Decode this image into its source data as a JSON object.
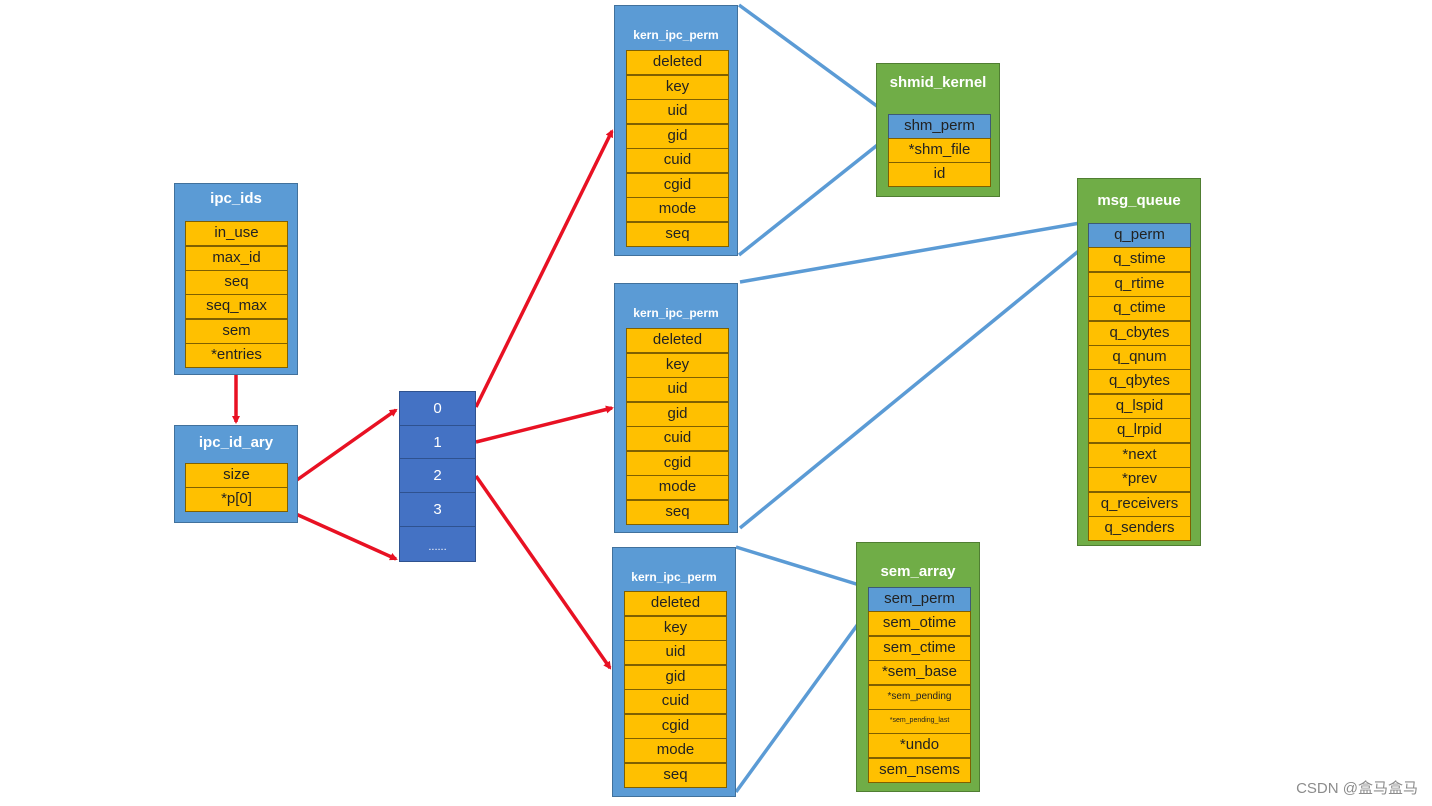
{
  "diagram": {
    "structs": {
      "ipc_ids": {
        "title": "ipc_ids",
        "fields": [
          "in_use",
          "max_id",
          "seq",
          "seq_max",
          "sem",
          "*entries"
        ]
      },
      "ipc_id_ary": {
        "title": "ipc_id_ary",
        "fields": [
          "size",
          "*p[0]"
        ]
      },
      "entries_array": {
        "cells": [
          "0",
          "1",
          "2",
          "3",
          "......"
        ]
      },
      "kern_ipc_perm_0": {
        "title": "kern_ipc_perm",
        "fields": [
          "deleted",
          "key",
          "uid",
          "gid",
          "cuid",
          "cgid",
          "mode",
          "seq"
        ]
      },
      "kern_ipc_perm_1": {
        "title": "kern_ipc_perm",
        "fields": [
          "deleted",
          "key",
          "uid",
          "gid",
          "cuid",
          "cgid",
          "mode",
          "seq"
        ]
      },
      "kern_ipc_perm_2": {
        "title": "kern_ipc_perm",
        "fields": [
          "deleted",
          "key",
          "uid",
          "gid",
          "cuid",
          "cgid",
          "mode",
          "seq"
        ]
      },
      "shmid_kernel": {
        "title": "shmid_kernel",
        "fields": [
          "shm_perm",
          "*shm_file",
          "id"
        ]
      },
      "msg_queue": {
        "title": "msg_queue",
        "fields": [
          "q_perm",
          "q_stime",
          "q_rtime",
          "q_ctime",
          "q_cbytes",
          "q_qnum",
          "q_qbytes",
          "q_lspid",
          "q_lrpid",
          "*next",
          "*prev",
          "q_receivers",
          "q_senders"
        ]
      },
      "sem_array": {
        "title": "sem_array",
        "fields": [
          "sem_perm",
          "sem_otime",
          "sem_ctime",
          "*sem_base",
          "*sem_pending",
          "*sem_pending_last",
          "*undo",
          "sem_nsems"
        ]
      }
    },
    "edges": [
      {
        "from": "ipc_ids.*entries",
        "to": "ipc_id_ary",
        "color": "#e81123"
      },
      {
        "from": "ipc_id_ary.*p[0]",
        "to": "entries_array.0",
        "color": "#e81123"
      },
      {
        "from": "ipc_id_ary.*p[0]",
        "to": "entries_array.end",
        "color": "#e81123"
      },
      {
        "from": "entries_array.0",
        "to": "kern_ipc_perm_0",
        "color": "#e81123"
      },
      {
        "from": "entries_array.1",
        "to": "kern_ipc_perm_1",
        "color": "#e81123"
      },
      {
        "from": "entries_array.2",
        "to": "kern_ipc_perm_2",
        "color": "#e81123"
      },
      {
        "from": "kern_ipc_perm_0",
        "to": "shmid_kernel.shm_perm",
        "color": "#5b9bd5"
      },
      {
        "from": "kern_ipc_perm_1",
        "to": "msg_queue.q_perm",
        "color": "#5b9bd5"
      },
      {
        "from": "kern_ipc_perm_2",
        "to": "sem_array.sem_perm",
        "color": "#5b9bd5"
      }
    ],
    "colors": {
      "struct_blue": "#5b9bd5",
      "struct_green": "#70ad47",
      "field_yellow": "#ffc000",
      "array_blue": "#4472c4",
      "pointer_red": "#e81123",
      "perm_link_blue": "#5b9bd5"
    }
  },
  "watermark": "CSDN @盒马盒马"
}
